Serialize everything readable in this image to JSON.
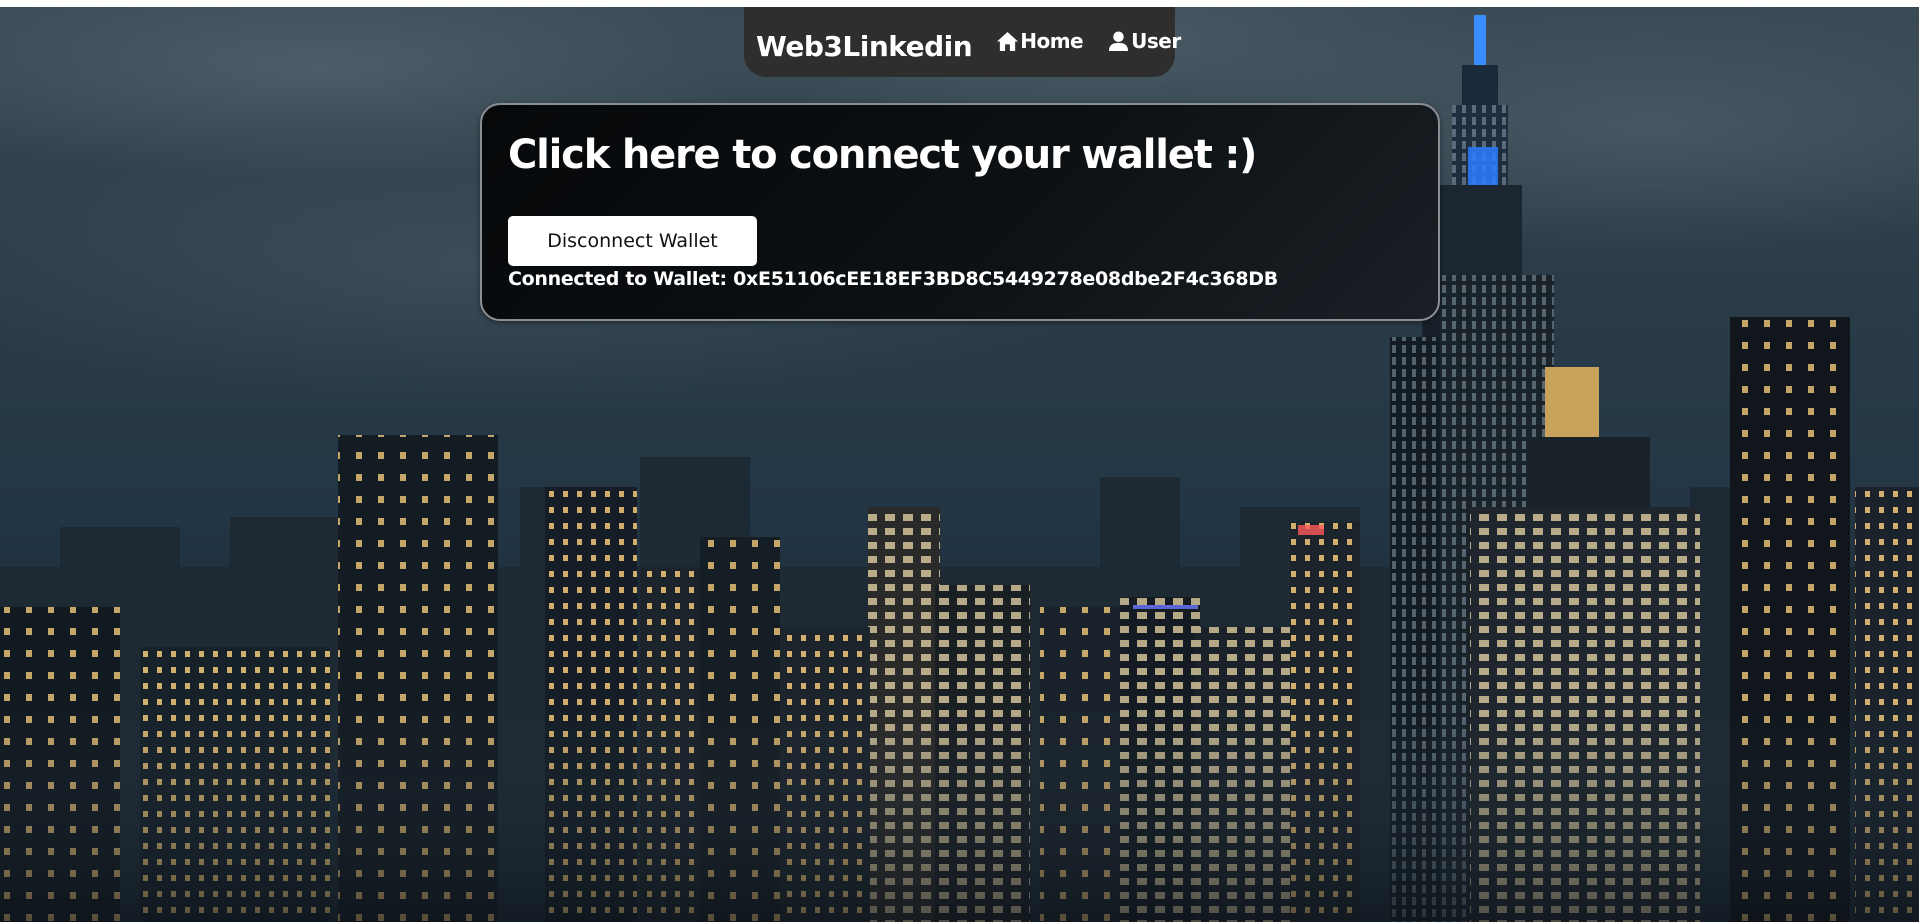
{
  "navbar": {
    "brand": "Web3Linkedin",
    "links": [
      {
        "label": "Home",
        "icon": "home-icon"
      },
      {
        "label": "User",
        "icon": "user-icon"
      }
    ],
    "background": "#2e2e2e"
  },
  "wallet_card": {
    "title": "Click here to connect your wallet :)",
    "button_label": "Disconnect Wallet",
    "status_text": "Connected to Wallet: 0xE51106cEE18EF3BD8C5449278e08dbe2F4c368DB"
  },
  "background": {
    "description_icon": "city-skyline-background",
    "colors": {
      "sky_top": "#3a4a55",
      "sky_bottom": "#131d26",
      "accent_blue": "#3a8cff",
      "window_light": "#f2c879"
    }
  }
}
